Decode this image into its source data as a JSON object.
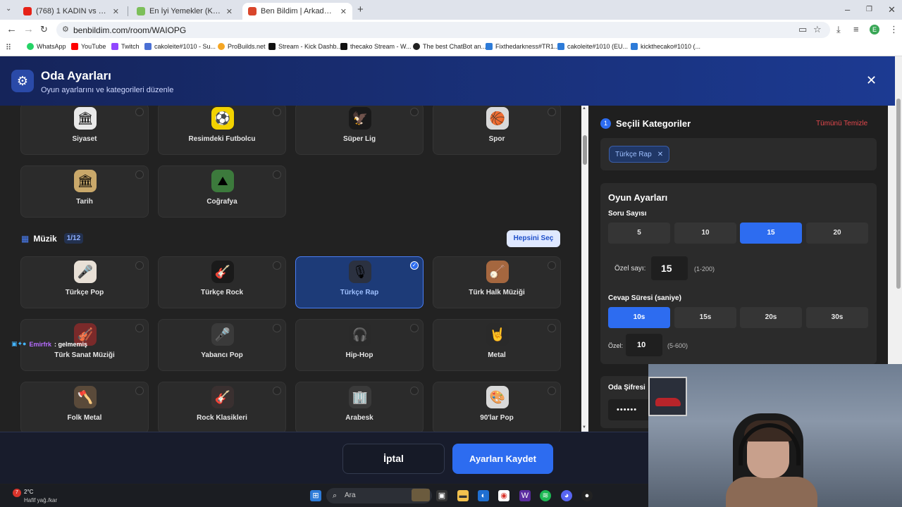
{
  "browser": {
    "tabs": [
      {
        "title": "(768) 1 KADIN vs 5 ERKEK| KIYA",
        "color": "#e62117"
      },
      {
        "title": "En İyi Yemekler (Karışık) - Tier L",
        "color": "#7cbf5a"
      },
      {
        "title": "Ben Bildim | Arkadaşlarınla Onl",
        "color": "#d9462b"
      }
    ],
    "url": "benbildim.com/room/WAIOPG",
    "profile_letter": "E",
    "bookmarks": [
      {
        "label": "WhatsApp",
        "color": "#25d366"
      },
      {
        "label": "YouTube",
        "color": "#ff0000"
      },
      {
        "label": "Twitch",
        "color": "#9146ff"
      },
      {
        "label": "cakoleite#1010 - Su...",
        "color": "#4a6fd4"
      },
      {
        "label": "ProBuilds.net",
        "color": "#f5a623"
      },
      {
        "label": "Stream - Kick Dashb...",
        "color": "#111111"
      },
      {
        "label": "thecako Stream - W...",
        "color": "#111111"
      },
      {
        "label": "The best ChatBot an...",
        "color": "#222222"
      },
      {
        "label": "Fixthedarkness#TR1...",
        "color": "#2d7bd8"
      },
      {
        "label": "cakoleite#1010 (EU...",
        "color": "#2d7bd8"
      },
      {
        "label": "kickthecako#1010 (...",
        "color": "#2d7bd8"
      }
    ]
  },
  "modal": {
    "title": "Oda Ayarları",
    "subtitle": "Oyun ayarlarını ve kategorileri düzenle"
  },
  "categories_top": [
    {
      "label": "Siyaset",
      "icon": "🏛",
      "bg": "#e9e9e9"
    },
    {
      "label": "Resimdeki Futbolcu",
      "icon": "⚽",
      "bg": "#f2d200"
    },
    {
      "label": "Süper Lig",
      "icon": "🦅",
      "bg": "#1a1a1a"
    },
    {
      "label": "Spor",
      "icon": "🏀",
      "bg": "#d9d9d9"
    },
    {
      "label": "Tarih",
      "icon": "🏛",
      "bg": "#c9a86a"
    },
    {
      "label": "Coğrafya",
      "icon": "⛰",
      "bg": "#3c7a3c"
    }
  ],
  "music_section": {
    "title": "Müzik",
    "count": "1/12",
    "select_all": "Hepsini Seç"
  },
  "music_categories": [
    {
      "label": "Türkçe Pop",
      "icon": "🎤",
      "bg": "#e8e0d6",
      "selected": false
    },
    {
      "label": "Türkçe Rock",
      "icon": "🎸",
      "bg": "#1a1a1a",
      "selected": false
    },
    {
      "label": "Türkçe Rap",
      "icon": "🎙",
      "bg": "#2b3140",
      "selected": true
    },
    {
      "label": "Türk Halk Müziği",
      "icon": "🪕",
      "bg": "#a5673f",
      "selected": false
    },
    {
      "label": "Türk Sanat Müziği",
      "icon": "🎻",
      "bg": "#7a2a2a",
      "selected": false
    },
    {
      "label": "Yabancı Pop",
      "icon": "🎤",
      "bg": "#3a3a3a",
      "selected": false
    },
    {
      "label": "Hip-Hop",
      "icon": "🎧",
      "bg": "#2a2a2a",
      "selected": false
    },
    {
      "label": "Metal",
      "icon": "🤘",
      "bg": "#2a2a2a",
      "selected": false
    },
    {
      "label": "Folk Metal",
      "icon": "🪓",
      "bg": "#5a4a3a",
      "selected": false
    },
    {
      "label": "Rock Klasikleri",
      "icon": "🎸",
      "bg": "#3a3030",
      "selected": false
    },
    {
      "label": "Arabesk",
      "icon": "🏢",
      "bg": "#3a3a3a",
      "selected": false
    },
    {
      "label": "90'lar Pop",
      "icon": "🎨",
      "bg": "#d9d9d9",
      "selected": false
    }
  ],
  "selected_panel": {
    "step": "1",
    "title": "Seçili Kategoriler",
    "clear_all": "Tümünü Temizle",
    "chips": [
      "Türkçe Rap"
    ]
  },
  "game_settings": {
    "title": "Oyun Ayarları",
    "question_count_label": "Soru Sayısı",
    "question_options": [
      "5",
      "10",
      "15",
      "20"
    ],
    "question_selected": "15",
    "custom_count_label": "Özel sayı:",
    "custom_count_value": "15",
    "custom_count_range": "(1-200)",
    "answer_time_label": "Cevap Süresi (saniye)",
    "time_options": [
      "10s",
      "15s",
      "20s",
      "30s"
    ],
    "time_selected": "10s",
    "custom_time_label": "Özel:",
    "custom_time_value": "10",
    "custom_time_range": "(5-600)"
  },
  "password": {
    "label": "Oda Şifresi",
    "value": "••••••"
  },
  "footer": {
    "cancel": "İptal",
    "save": "Ayarları Kaydet"
  },
  "chat_overlay": {
    "user": "Emirfrk",
    "message": ": gelmemiş"
  },
  "taskbar": {
    "temperature": "2°C",
    "condition": "Hafif yağ./kar",
    "badge": "7",
    "search_placeholder": "Ara"
  }
}
